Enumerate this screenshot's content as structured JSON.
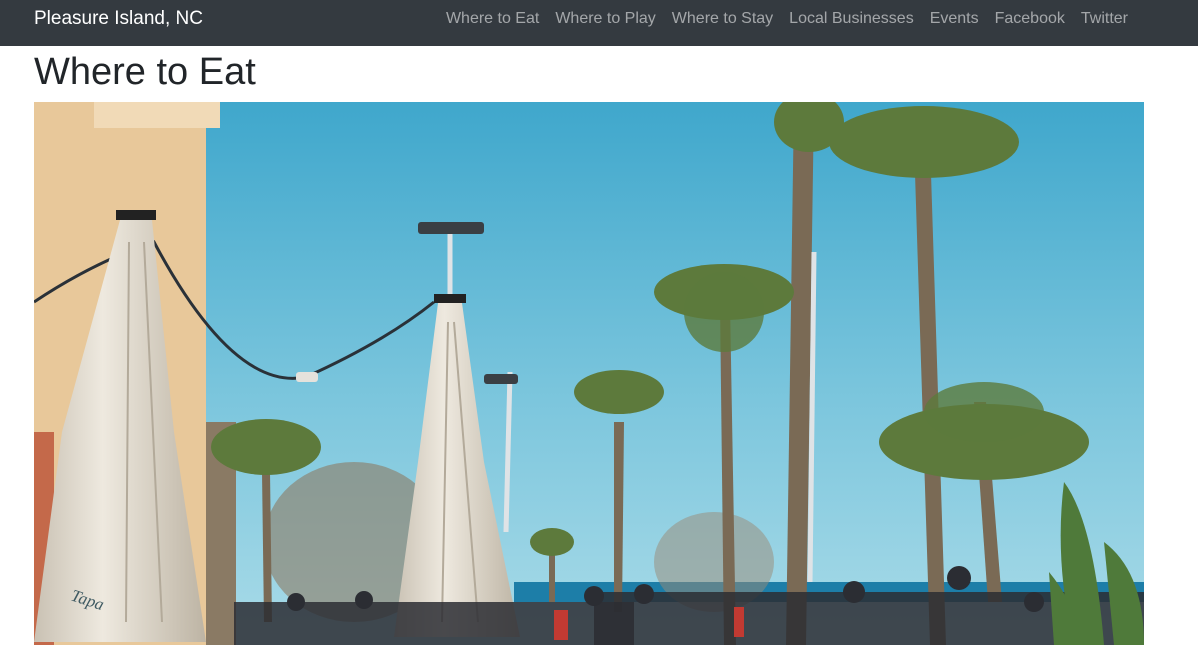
{
  "navbar": {
    "brand": "Pleasure Island, NC",
    "links": [
      "Where to Eat",
      "Where to Play",
      "Where to Stay",
      "Local Businesses",
      "Events",
      "Facebook",
      "Twitter"
    ]
  },
  "main": {
    "title": "Where to Eat",
    "hero": {
      "umbrella_text": "Tapa"
    }
  },
  "colors": {
    "navbar_bg": "#343a40",
    "sky": "#5cb8d6",
    "sea": "#1d7ea8"
  }
}
